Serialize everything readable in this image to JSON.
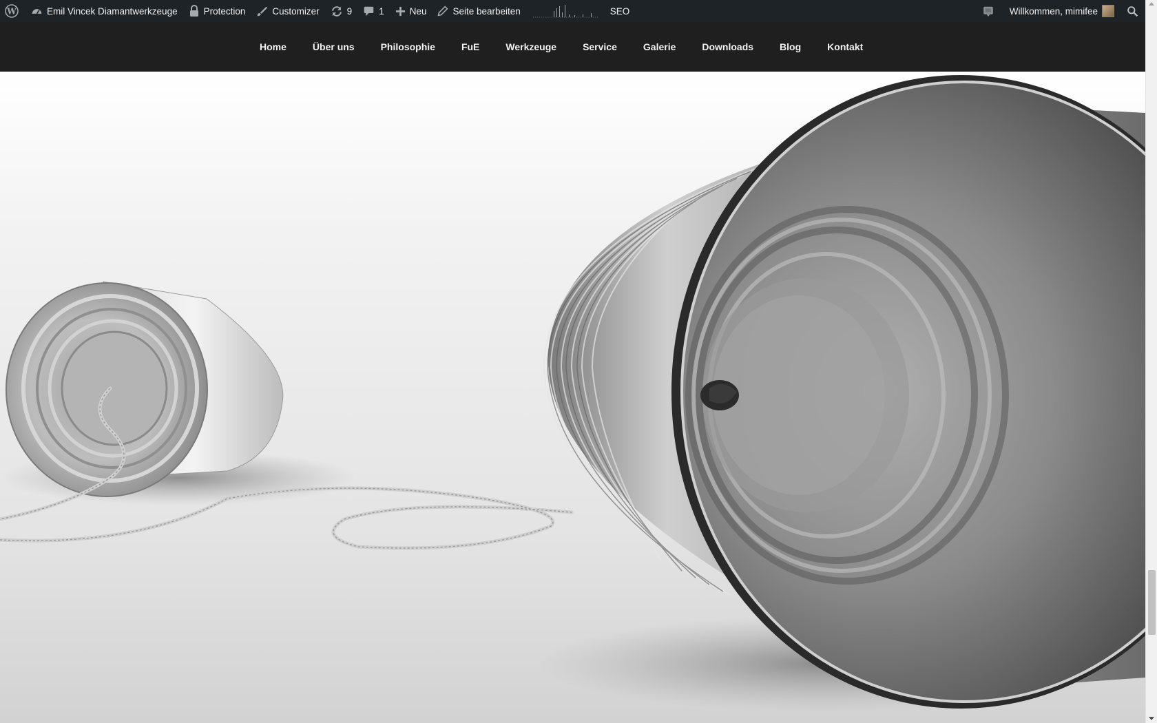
{
  "adminbar": {
    "site_name": "Emil Vincek Diamantwerkzeuge",
    "protection": "Protection",
    "customizer": "Customizer",
    "updates_count": "9",
    "comments_count": "1",
    "new_label": "Neu",
    "edit_page": "Seite bearbeiten",
    "seo": "SEO",
    "welcome": "Willkommen, mimifee",
    "icons": {
      "wp": "wordpress-logo-icon",
      "site": "dashboard-gauge-icon",
      "protection": "lock-icon",
      "customizer": "paintbrush-icon",
      "updates": "refresh-icon",
      "comments": "speech-bubble-icon",
      "new": "plus-icon",
      "edit": "pencil-icon",
      "stats": "sparkline-icon",
      "notification": "notification-bubble-icon",
      "search": "search-icon"
    }
  },
  "nav": {
    "items": [
      "Home",
      "Über uns",
      "Philosophie",
      "FuE",
      "Werkzeuge",
      "Service",
      "Galerie",
      "Downloads",
      "Blog",
      "Kontakt"
    ]
  },
  "hero": {
    "image": "tin-can-telephone-photo"
  },
  "colors": {
    "adminbar_bg": "#1d2327",
    "nav_bg": "#1f1f1f",
    "nav_text": "#f2f2f2"
  }
}
